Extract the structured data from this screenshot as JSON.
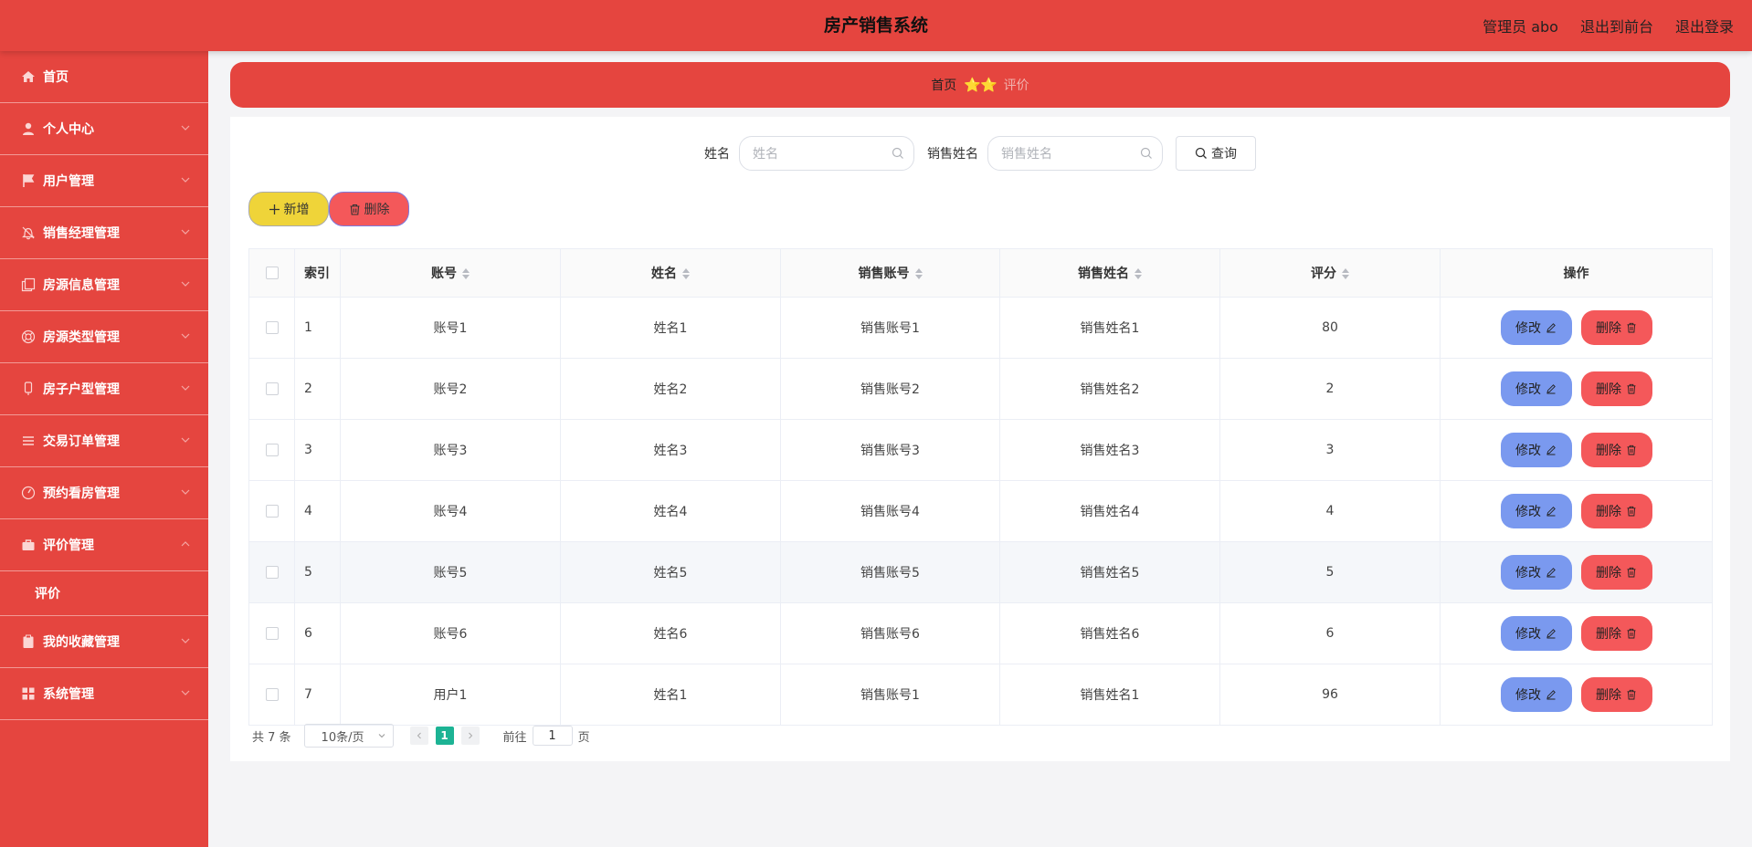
{
  "header": {
    "title": "房产销售系统",
    "user_label": "管理员 abo",
    "front_link": "退出到前台",
    "logout_link": "退出登录",
    "bg_color": "#e5453f"
  },
  "sidebar": {
    "items": [
      {
        "label": "首页",
        "icon": "home-icon"
      },
      {
        "label": "个人中心",
        "icon": "user-icon"
      },
      {
        "label": "用户管理",
        "icon": "flag-icon"
      },
      {
        "label": "销售经理管理",
        "icon": "bell-icon"
      },
      {
        "label": "房源信息管理",
        "icon": "copy-icon"
      },
      {
        "label": "房源类型管理",
        "icon": "lifebuoy-icon"
      },
      {
        "label": "房子户型管理",
        "icon": "phone-icon"
      },
      {
        "label": "交易订单管理",
        "icon": "menu-icon"
      },
      {
        "label": "预约看房管理",
        "icon": "gauge-icon"
      },
      {
        "label": "评价管理",
        "icon": "briefcase-icon"
      },
      {
        "label": "我的收藏管理",
        "icon": "clipboard-icon"
      },
      {
        "label": "系统管理",
        "icon": "grid-icon"
      }
    ],
    "submenu": {
      "label": "评价"
    }
  },
  "breadcrumb": {
    "home": "首页",
    "separator": "⭐⭐",
    "current": "评价"
  },
  "search": {
    "name_label": "姓名",
    "name_placeholder": "姓名",
    "sales_label": "销售姓名",
    "sales_placeholder": "销售姓名",
    "query_label": "查询"
  },
  "actions": {
    "add_label": "新增",
    "delete_label": "删除"
  },
  "table": {
    "headers": {
      "index": "索引",
      "account": "账号",
      "name": "姓名",
      "sales_account": "销售账号",
      "sales_name": "销售姓名",
      "score": "评分",
      "ops": "操作"
    },
    "edit_label": "修改",
    "delete_label": "删除",
    "rows": [
      {
        "index": "1",
        "account": "账号1",
        "name": "姓名1",
        "sales_account": "销售账号1",
        "sales_name": "销售姓名1",
        "score": "80"
      },
      {
        "index": "2",
        "account": "账号2",
        "name": "姓名2",
        "sales_account": "销售账号2",
        "sales_name": "销售姓名2",
        "score": "2"
      },
      {
        "index": "3",
        "account": "账号3",
        "name": "姓名3",
        "sales_account": "销售账号3",
        "sales_name": "销售姓名3",
        "score": "3"
      },
      {
        "index": "4",
        "account": "账号4",
        "name": "姓名4",
        "sales_account": "销售账号4",
        "sales_name": "销售姓名4",
        "score": "4"
      },
      {
        "index": "5",
        "account": "账号5",
        "name": "姓名5",
        "sales_account": "销售账号5",
        "sales_name": "销售姓名5",
        "score": "5"
      },
      {
        "index": "6",
        "account": "账号6",
        "name": "姓名6",
        "sales_account": "销售账号6",
        "sales_name": "销售姓名6",
        "score": "6"
      },
      {
        "index": "7",
        "account": "用户1",
        "name": "姓名1",
        "sales_account": "销售账号1",
        "sales_name": "销售姓名1",
        "score": "96"
      }
    ]
  },
  "pagination": {
    "total": "共 7 条",
    "page_size": "10条/页",
    "current_page": "1",
    "goto_prefix": "前往",
    "goto_value": "1",
    "goto_suffix": "页"
  }
}
